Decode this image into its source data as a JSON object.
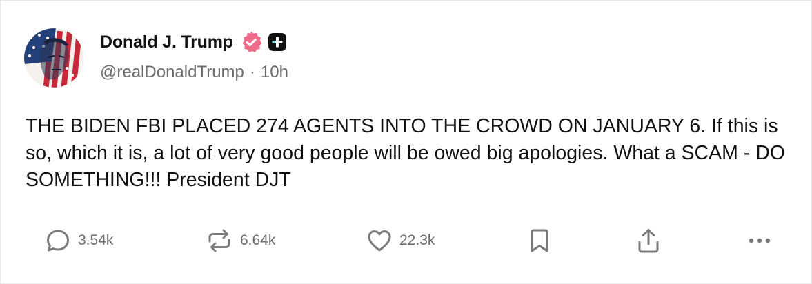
{
  "author": {
    "display_name": "Donald J. Trump",
    "handle": "@realDonaldTrump",
    "separator": "·",
    "time_ago": "10h",
    "verified_icon": "verified-check-icon",
    "plus_icon": "plus-badge-icon",
    "avatar_icon": "avatar-flag-portrait"
  },
  "post": {
    "text": "THE BIDEN FBI PLACED 274 AGENTS INTO THE CROWD ON JANUARY 6. If this is so, which it is, a lot of very good people will be owed big apologies. What a SCAM - DO SOMETHING!!! President DJT"
  },
  "actions": {
    "replies": {
      "icon": "reply-icon",
      "count": "3.54k"
    },
    "retruths": {
      "icon": "repost-icon",
      "count": "6.64k"
    },
    "likes": {
      "icon": "heart-icon",
      "count": "22.3k"
    },
    "bookmark": {
      "icon": "bookmark-icon"
    },
    "share": {
      "icon": "share-icon"
    },
    "more": {
      "icon": "more-icon"
    }
  },
  "colors": {
    "verified_badge": "#f06a8a",
    "plus_badge": "#111111",
    "text_primary": "#111111",
    "text_secondary": "#6b6b6b",
    "icon_gray": "#7a7a7a"
  }
}
